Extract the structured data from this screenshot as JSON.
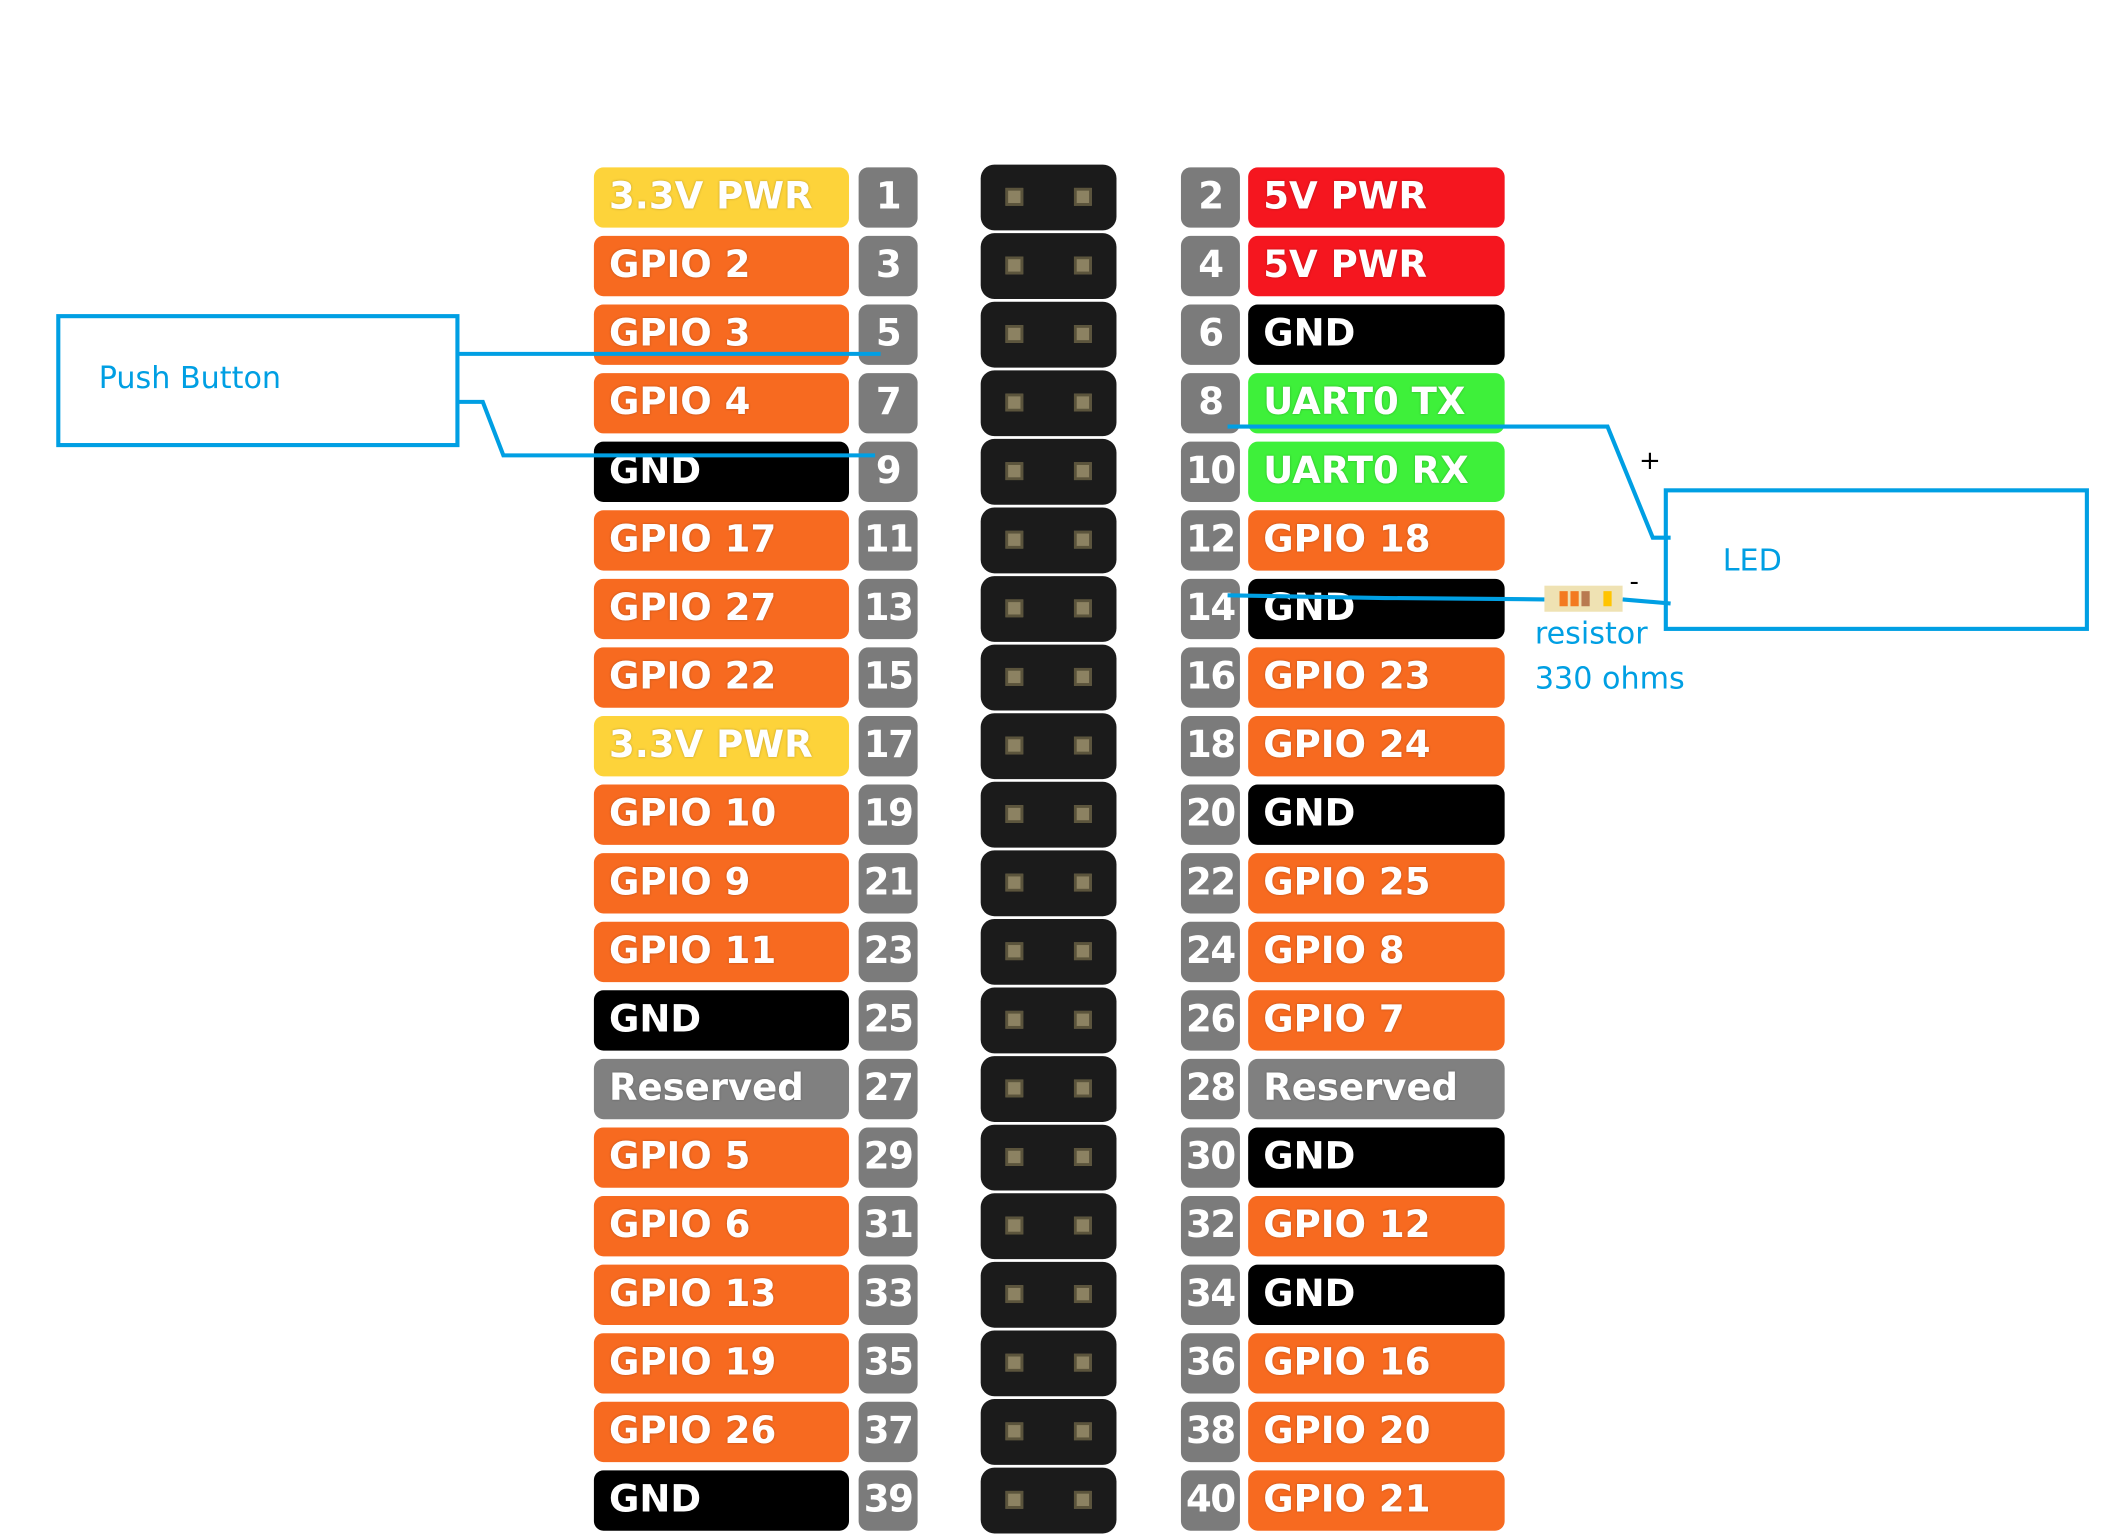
{
  "colors": {
    "power33": "#fdd33a",
    "power5": "#f5161f",
    "gpio": "#f76a20",
    "gnd": "#000000",
    "uart": "#3ef03a",
    "reserved": "#808080",
    "pinNumber": "#7b7b7b",
    "wire": "#009fe3"
  },
  "pins": [
    {
      "left": {
        "num": "1",
        "label": "3.3V PWR",
        "type": "power33"
      },
      "right": {
        "num": "2",
        "label": "5V PWR",
        "type": "power5"
      }
    },
    {
      "left": {
        "num": "3",
        "label": "GPIO 2",
        "type": "gpio"
      },
      "right": {
        "num": "4",
        "label": "5V PWR",
        "type": "power5"
      }
    },
    {
      "left": {
        "num": "5",
        "label": "GPIO 3",
        "type": "gpio"
      },
      "right": {
        "num": "6",
        "label": "GND",
        "type": "gnd"
      }
    },
    {
      "left": {
        "num": "7",
        "label": "GPIO 4",
        "type": "gpio"
      },
      "right": {
        "num": "8",
        "label": "UART0 TX",
        "type": "uart"
      }
    },
    {
      "left": {
        "num": "9",
        "label": "GND",
        "type": "gnd"
      },
      "right": {
        "num": "10",
        "label": "UART0 RX",
        "type": "uart"
      }
    },
    {
      "left": {
        "num": "11",
        "label": "GPIO 17",
        "type": "gpio"
      },
      "right": {
        "num": "12",
        "label": "GPIO 18",
        "type": "gpio"
      }
    },
    {
      "left": {
        "num": "13",
        "label": "GPIO 27",
        "type": "gpio"
      },
      "right": {
        "num": "14",
        "label": "GND",
        "type": "gnd"
      }
    },
    {
      "left": {
        "num": "15",
        "label": "GPIO 22",
        "type": "gpio"
      },
      "right": {
        "num": "16",
        "label": "GPIO 23",
        "type": "gpio"
      }
    },
    {
      "left": {
        "num": "17",
        "label": "3.3V PWR",
        "type": "power33"
      },
      "right": {
        "num": "18",
        "label": "GPIO 24",
        "type": "gpio"
      }
    },
    {
      "left": {
        "num": "19",
        "label": "GPIO 10",
        "type": "gpio"
      },
      "right": {
        "num": "20",
        "label": "GND",
        "type": "gnd"
      }
    },
    {
      "left": {
        "num": "21",
        "label": "GPIO 9",
        "type": "gpio"
      },
      "right": {
        "num": "22",
        "label": "GPIO 25",
        "type": "gpio"
      }
    },
    {
      "left": {
        "num": "23",
        "label": "GPIO 11",
        "type": "gpio"
      },
      "right": {
        "num": "24",
        "label": "GPIO 8",
        "type": "gpio"
      }
    },
    {
      "left": {
        "num": "25",
        "label": "GND",
        "type": "gnd"
      },
      "right": {
        "num": "26",
        "label": "GPIO 7",
        "type": "gpio"
      }
    },
    {
      "left": {
        "num": "27",
        "label": "Reserved",
        "type": "reserved"
      },
      "right": {
        "num": "28",
        "label": "Reserved",
        "type": "reserved"
      }
    },
    {
      "left": {
        "num": "29",
        "label": "GPIO 5",
        "type": "gpio"
      },
      "right": {
        "num": "30",
        "label": "GND",
        "type": "gnd"
      }
    },
    {
      "left": {
        "num": "31",
        "label": "GPIO 6",
        "type": "gpio"
      },
      "right": {
        "num": "32",
        "label": "GPIO 12",
        "type": "gpio"
      }
    },
    {
      "left": {
        "num": "33",
        "label": "GPIO 13",
        "type": "gpio"
      },
      "right": {
        "num": "34",
        "label": "GND",
        "type": "gnd"
      }
    },
    {
      "left": {
        "num": "35",
        "label": "GPIO 19",
        "type": "gpio"
      },
      "right": {
        "num": "36",
        "label": "GPIO 16",
        "type": "gpio"
      }
    },
    {
      "left": {
        "num": "37",
        "label": "GPIO 26",
        "type": "gpio"
      },
      "right": {
        "num": "38",
        "label": "GPIO 20",
        "type": "gpio"
      }
    },
    {
      "left": {
        "num": "39",
        "label": "GND",
        "type": "gnd"
      },
      "right": {
        "num": "40",
        "label": "GPIO 21",
        "type": "gpio"
      }
    }
  ],
  "pushButton": {
    "label": "Push Button"
  },
  "led": {
    "label": "LED",
    "plus": "+",
    "minus": "-"
  },
  "resistor": {
    "label": "resistor",
    "value": "330 ohms",
    "bands": [
      "#f37a20",
      "#f37a20",
      "#b97a50",
      "#ffc400"
    ]
  }
}
